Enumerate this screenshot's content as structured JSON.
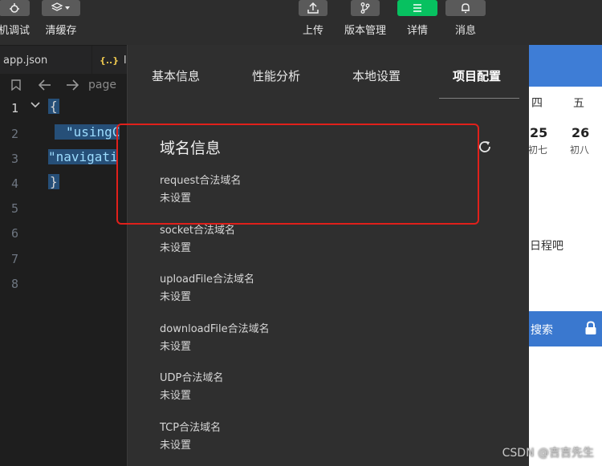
{
  "toolbar": {
    "left_buttons": [
      {
        "label": "机调试",
        "icon": "bug-icon"
      },
      {
        "label": "清缓存",
        "icon": "layers-icon"
      }
    ],
    "right_buttons": [
      {
        "label": "上传",
        "icon": "upload-icon"
      },
      {
        "label": "版本管理",
        "icon": "branch-icon"
      },
      {
        "label": "详情",
        "icon": "menu-icon"
      },
      {
        "label": "消息",
        "icon": "bell-icon"
      }
    ]
  },
  "editor": {
    "tabs": [
      {
        "label": "app.json"
      },
      {
        "label": "l",
        "badge": "{..}"
      }
    ],
    "breadcrumb": "page",
    "line_numbers": [
      "1",
      "2",
      "3",
      "4",
      "5",
      "6",
      "7",
      "8"
    ],
    "lines": [
      "{",
      "\"usingC",
      "\"navigati",
      "}"
    ]
  },
  "panel": {
    "tabs": [
      "基本信息",
      "性能分析",
      "本地设置",
      "项目配置"
    ],
    "active_tab": "项目配置",
    "section_title": "域名信息",
    "items": [
      {
        "name": "request合法域名",
        "value": "未设置"
      },
      {
        "name": "socket合法域名",
        "value": "未设置"
      },
      {
        "name": "uploadFile合法域名",
        "value": "未设置"
      },
      {
        "name": "downloadFile合法域名",
        "value": "未设置"
      },
      {
        "name": "UDP合法域名",
        "value": "未设置"
      },
      {
        "name": "TCP合法域名",
        "value": "未设置"
      }
    ]
  },
  "simulator": {
    "weekdays": [
      "四",
      "五"
    ],
    "days": [
      "25",
      "26"
    ],
    "lunar": [
      "初七",
      "初八"
    ],
    "schedule_text": "日程吧",
    "search_label": "搜索"
  },
  "watermark": "CSDN @吉吉先生"
}
